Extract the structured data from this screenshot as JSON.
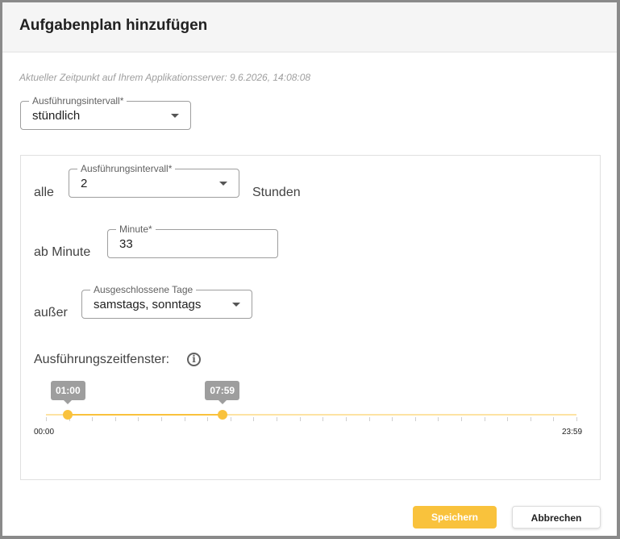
{
  "dialog": {
    "title": "Aufgabenplan hinzufügen",
    "server_time": "Aktueller Zeitpunkt auf Ihrem Applikationsserver: 9.6.2026, 14:08:08"
  },
  "interval_select": {
    "label": "Ausführungsintervall*",
    "value": "stündlich"
  },
  "schedule": {
    "every_prefix": "alle",
    "every_select": {
      "label": "Ausführungsintervall*",
      "value": "2"
    },
    "every_suffix": "Stunden",
    "minute_prefix": "ab Minute",
    "minute_field": {
      "label": "Minute*",
      "value": "33"
    },
    "except_prefix": "außer",
    "excluded_select": {
      "label": "Ausgeschlossene Tage",
      "value": "samstags, sonntags"
    },
    "window_label": "Ausführungszeitfenster:",
    "info_icon": "info-icon",
    "slider": {
      "min_label": "00:00",
      "max_label": "23:59",
      "start_label": "01:00",
      "end_label": "07:59",
      "start_fraction": 0.0417,
      "end_fraction": 0.3326
    }
  },
  "buttons": {
    "save": "Speichern",
    "cancel": "Abbrechen"
  },
  "colors": {
    "accent": "#f9c23c",
    "accent_light": "#fde3a3",
    "header_bg": "#f5f5f5"
  }
}
